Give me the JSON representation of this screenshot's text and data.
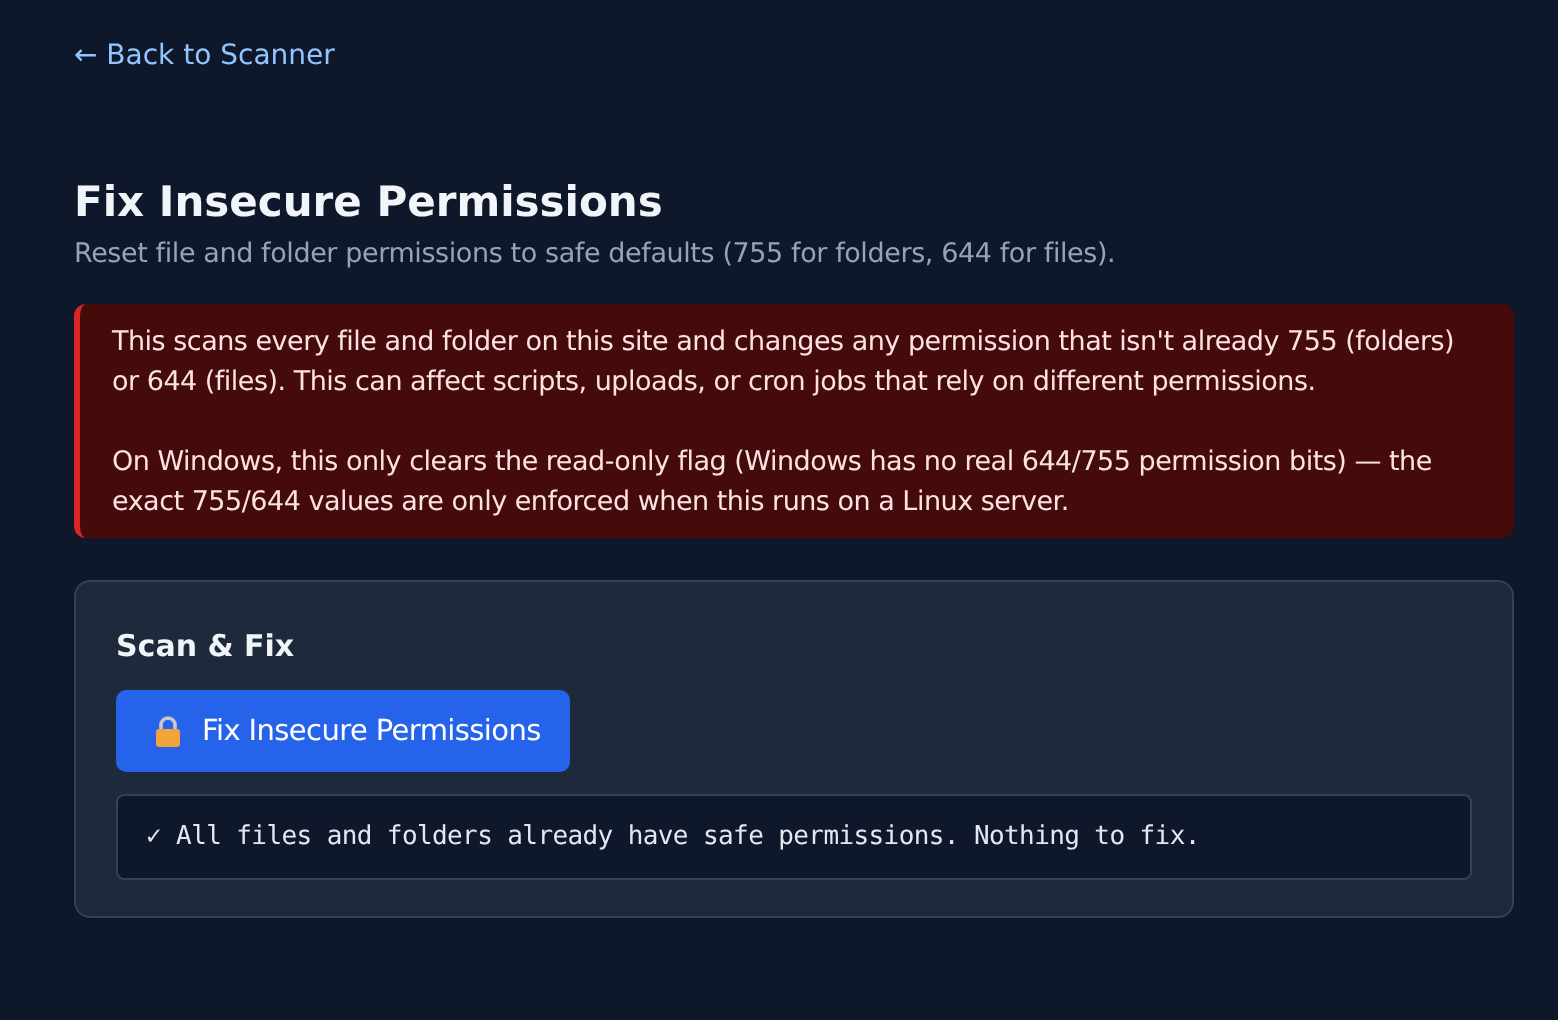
{
  "back_link": "← Back to Scanner",
  "title": "Fix Insecure Permissions",
  "subtitle": "Reset file and folder permissions to safe defaults (755 for folders, 644 for files).",
  "warning": {
    "paragraphs": [
      "This scans every file and folder on this site and changes any permission that isn't already 755 (folders) or 644 (files). This can affect scripts, uploads, or cron jobs that rely on different permissions.",
      "On Windows, this only clears the read-only flag (Windows has no real 644/755 permission bits) — the exact 755/644 values are only enforced when this runs on a Linux server."
    ]
  },
  "card": {
    "title": "Scan & Fix",
    "button": "Fix Insecure Permissions",
    "output": "✓ All files and folders already have safe permissions. Nothing to fix."
  }
}
